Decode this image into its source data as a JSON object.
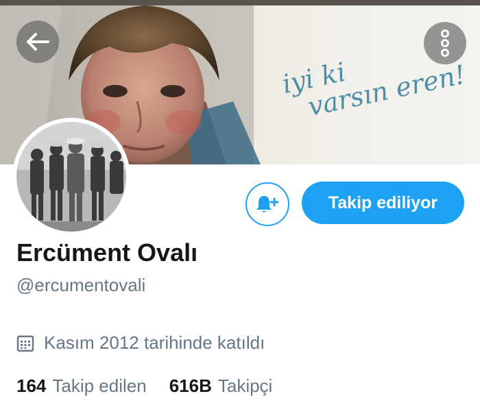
{
  "header": {
    "banner_caption_line1": "iyi ki",
    "banner_caption_line2": "varsın eren!",
    "back_icon": "arrow-left-icon",
    "more_icon": "vertical-dots-icon"
  },
  "profile": {
    "name": "Ercüment Ovalı",
    "handle": "@ercumentovali",
    "joined": "Kasım 2012 tarihinde katıldı",
    "joined_icon": "calendar-icon"
  },
  "actions": {
    "notify_icon": "bell-plus-icon",
    "follow_label": "Takip ediliyor"
  },
  "stats": {
    "following_count": "164",
    "following_label": "Takip edilen",
    "followers_count": "616B",
    "followers_label": "Takipçi"
  },
  "colors": {
    "accent": "#1da1f2",
    "secondary_text": "#657786",
    "primary_text": "#14171a"
  }
}
